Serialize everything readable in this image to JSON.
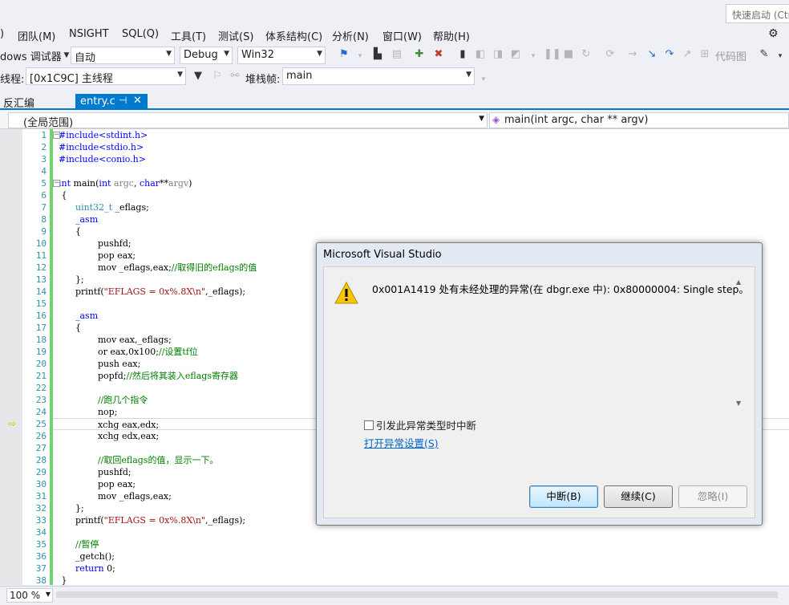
{
  "titlebar": {
    "quick_launch": "快速启动 (Ctrl+Q)"
  },
  "menu": [
    "团队(M)",
    "NSIGHT",
    "SQL(Q)",
    "工具(T)",
    "测试(S)",
    "体系结构(C)",
    "分析(N)",
    "窗口(W)",
    "帮助(H)"
  ],
  "toolbar1": {
    "debugger_label": "dows 调试器",
    "auto": "自动",
    "config": "Debug",
    "platform": "Win32",
    "code_map": "代码图"
  },
  "toolbar2": {
    "thread_label": "线程:",
    "thread_value": "[0x1C9C] 主线程",
    "stack_label": "堆栈帧:",
    "stack_value": "main"
  },
  "tabs": {
    "inactive": "反汇编",
    "active": "entry.c"
  },
  "navbar": {
    "scope": "(全局范围)",
    "member": "main(int argc, char ** argv)"
  },
  "line_numbers": [
    "1",
    "2",
    "3",
    "4",
    "5",
    "6",
    "7",
    "8",
    "9",
    "10",
    "11",
    "12",
    "13",
    "14",
    "15",
    "16",
    "17",
    "18",
    "19",
    "20",
    "21",
    "22",
    "23",
    "24",
    "25",
    "26",
    "27",
    "28",
    "29",
    "30",
    "31",
    "32",
    "33",
    "34",
    "35",
    "36",
    "37",
    "38"
  ],
  "code": {
    "l1": "#include<stdint.h>",
    "l2": "#include<stdio.h>",
    "l3": "#include<conio.h>",
    "l5_kw": "int",
    "l5_rest": " main(",
    "l5_kw2": "int",
    "l5_p1": " argc",
    "l5_sep": ", ",
    "l5_kw3": "char",
    "l5_ptr": "**",
    "l5_p2": "argv",
    "l5_end": ")",
    "l6": "{",
    "l7_type": "uint32_t",
    "l7_rest": " _eflags;",
    "l8": "_asm",
    "l9": "{",
    "l10": "pushfd;",
    "l11": "pop eax;",
    "l12_code": "mov _eflags,eax;",
    "l12_cmt": "//取得旧的eflags的值",
    "l13": "};",
    "l14_fn": "printf(",
    "l14_str": "\"EFLAGS = 0x%.8X\\n\"",
    "l14_end": ",_eflags);",
    "l16": "_asm",
    "l17": "{",
    "l18": "mov eax,_eflags;",
    "l19_code": "or eax,0x100;",
    "l19_cmt": "//设置tf位",
    "l20": "push eax;",
    "l21_code": "popfd;",
    "l21_cmt": "//然后将其装入eflags寄存器",
    "l23_cmt": "//跑几个指令",
    "l24": "nop;",
    "l25": "xchg eax,edx;",
    "l26": "xchg edx,eax;",
    "l28_cmt": "//取回eflags的值，显示一下。",
    "l29": "pushfd;",
    "l30": "pop eax;",
    "l31": "mov _eflags,eax;",
    "l32": "};",
    "l33_fn": "printf(",
    "l33_str": "\"EFLAGS = 0x%.8X\\n\"",
    "l33_end": ",_eflags);",
    "l35_cmt": "//暂停",
    "l36": "_getch();",
    "l37_kw": "return",
    "l37_rest": " 0;",
    "l38": "}"
  },
  "status": {
    "zoom": "100 %"
  },
  "dialog": {
    "title": "Microsoft Visual Studio",
    "message": "0x001A1419 处有未经处理的异常(在 dbgr.exe 中): 0x80000004: Single step。",
    "checkbox": "引发此异常类型时中断",
    "link": "打开异常设置(S)",
    "btn_break": "中断(B)",
    "btn_continue": "继续(C)",
    "btn_ignore": "忽略(I)"
  },
  "colors": {
    "accent": "#007acc",
    "keyword": "#0000ff",
    "string": "#a31515",
    "comment": "#008000",
    "type": "#2b91af"
  }
}
